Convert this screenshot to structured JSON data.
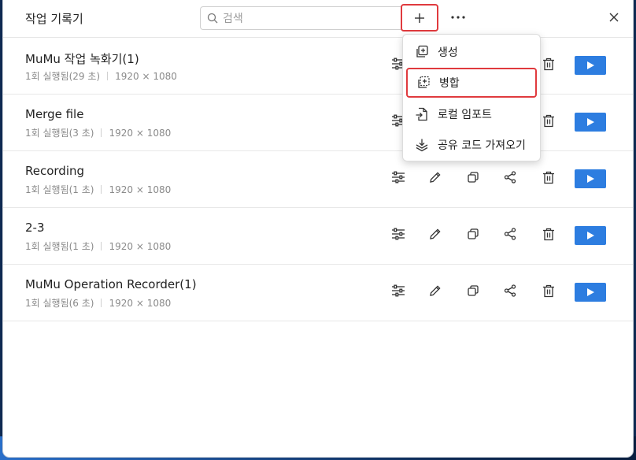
{
  "window": {
    "title": "작업 기록기"
  },
  "search": {
    "placeholder": "검색"
  },
  "menu": {
    "items": [
      {
        "label": "생성",
        "icon": "create-icon"
      },
      {
        "label": "병합",
        "icon": "merge-icon",
        "highlighted": true
      },
      {
        "label": "로컬 임포트",
        "icon": "import-file-icon"
      },
      {
        "label": "공유 코드 가져오기",
        "icon": "download-icon"
      }
    ]
  },
  "recordings": [
    {
      "name": "MuMu 작업 녹화기(1)",
      "runs": "1회 실행됨(29 초)",
      "resolution": "1920 × 1080"
    },
    {
      "name": "Merge file",
      "runs": "1회 실행됨(3 초)",
      "resolution": "1920 × 1080"
    },
    {
      "name": "Recording",
      "runs": "1회 실행됨(1 초)",
      "resolution": "1920 × 1080"
    },
    {
      "name": "2-3",
      "runs": "1회 실행됨(1 초)",
      "resolution": "1920 × 1080"
    },
    {
      "name": "MuMu Operation Recorder(1)",
      "runs": "1회 실행됨(6 초)",
      "resolution": "1920 × 1080"
    }
  ],
  "colors": {
    "accent": "#2d7de0",
    "highlight": "#e03a3e"
  }
}
